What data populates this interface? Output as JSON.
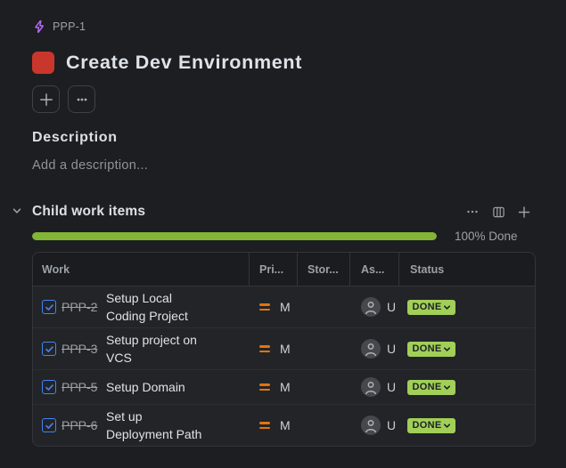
{
  "breadcrumb": {
    "key": "PPP-1"
  },
  "title": "Create Dev Environment",
  "description": {
    "heading": "Description",
    "placeholder": "Add a description..."
  },
  "child_work_items": {
    "heading": "Child work items",
    "progress_percent": 100,
    "progress_label": "100% Done",
    "columns": {
      "work": "Work",
      "priority": "Pri...",
      "story_points": "Stor...",
      "assignee": "As...",
      "status": "Status"
    },
    "rows": [
      {
        "key": "PPP-2",
        "name": "Setup Local Coding Project",
        "priority": "M",
        "assignee": "U",
        "status": "DONE",
        "checked": true
      },
      {
        "key": "PPP-3",
        "name": "Setup project on VCS",
        "priority": "M",
        "assignee": "U",
        "status": "DONE",
        "checked": true
      },
      {
        "key": "PPP-5",
        "name": "Setup Domain",
        "priority": "M",
        "assignee": "U",
        "status": "DONE",
        "checked": true
      },
      {
        "key": "PPP-6",
        "name": "Set up Deployment Path",
        "priority": "M",
        "assignee": "U",
        "status": "DONE",
        "checked": true
      }
    ]
  },
  "colors": {
    "background": "#1d1e21",
    "accent_purple": "#b668f2",
    "epic_red": "#c9372c",
    "checkbox_blue": "#4584f4",
    "priority_orange": "#e2740d",
    "progress_green": "#82b536",
    "status_green": "#9fce54"
  }
}
